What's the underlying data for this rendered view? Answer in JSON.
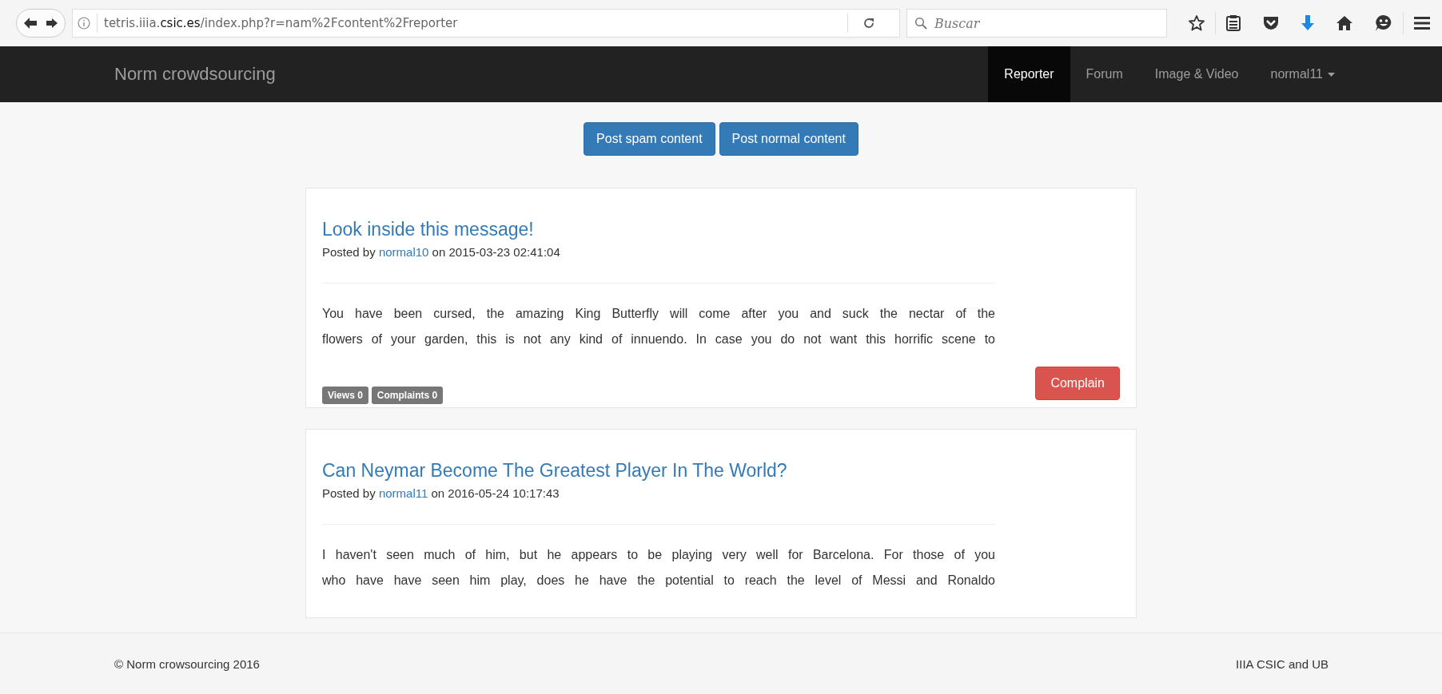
{
  "browser": {
    "url_host": "tetris.iiia.",
    "url_domain": "csic.es",
    "url_path": "/index.php?r=nam%2Fcontent%2Freporter",
    "search": {
      "placeholder": "Buscar"
    }
  },
  "navbar": {
    "brand": "Norm crowdsourcing",
    "items": [
      {
        "label": "Reporter",
        "selected": true,
        "kind": "link"
      },
      {
        "label": "Forum",
        "selected": false,
        "kind": "link"
      },
      {
        "label": "Image & Video",
        "selected": false,
        "kind": "link"
      },
      {
        "label": "normal11",
        "selected": false,
        "kind": "dropdown"
      }
    ]
  },
  "actions": [
    "Post spam content",
    "Post normal content"
  ],
  "posts": [
    {
      "title": "Look inside this message!",
      "posted_by": "Posted by",
      "author": "normal10",
      "on": "on 2015-03-23 02:41:04",
      "body_lines": [
        "You have been cursed, the amazing King Butterfly will come after you and suck the nectar of the",
        "flowers of your garden, this is not any kind of innuendo. In case you do not want this horrific scene to"
      ],
      "badges": [
        "Views 0",
        "Complaints 0"
      ],
      "action": "Complain"
    },
    {
      "title": "Can Neymar Become The Greatest Player In The World?",
      "posted_by": "Posted by",
      "author": "normal11",
      "on": "on 2016-05-24 10:17:43",
      "body_lines": [
        "I haven't seen much of him, but he appears to be playing very well for Barcelona. For those of you",
        "who have have seen him play, does he have the potential to reach the level of Messi and Ronaldo"
      ]
    }
  ],
  "footer": {
    "left": "© Norm crowsourcing 2016",
    "right": "IIIA CSIC and UB"
  }
}
